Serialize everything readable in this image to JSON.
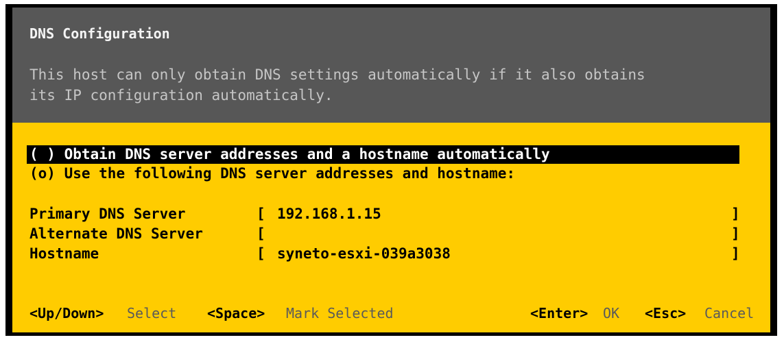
{
  "dialog": {
    "title": "DNS Configuration",
    "description_lines": [
      "This host can only obtain DNS settings automatically if it also obtains",
      "its IP configuration automatically."
    ]
  },
  "options": [
    {
      "marker": "( )",
      "label": "Obtain DNS server addresses and a hostname automatically",
      "selected_highlight": true
    },
    {
      "marker": "(o)",
      "label": "Use the following DNS server addresses and hostname:",
      "selected_highlight": false
    }
  ],
  "fields": [
    {
      "label": "Primary DNS Server",
      "value": "192.168.1.15"
    },
    {
      "label": "Alternate DNS Server",
      "value": ""
    },
    {
      "label": "Hostname",
      "value": "syneto-esxi-039a3038"
    }
  ],
  "footer": {
    "updown_key": "<Up/Down>",
    "updown_desc": "Select",
    "space_key": "<Space>",
    "space_desc": "Mark Selected",
    "enter_key": "<Enter>",
    "enter_desc": "OK",
    "esc_key": "<Esc>",
    "esc_desc": "Cancel"
  },
  "colors": {
    "header_bg": "#575757",
    "body_bg": "#ffcc00",
    "highlight_bg": "#000000"
  }
}
